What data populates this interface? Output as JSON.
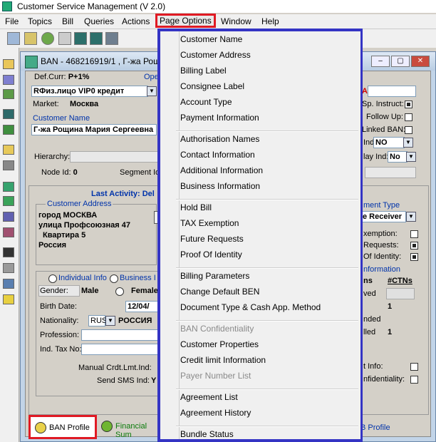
{
  "app": {
    "title": "Customer Service Management  (V 2.0)"
  },
  "menubar": [
    "File",
    "Topics",
    "Bill",
    "Queries",
    "Actions",
    "Page Options",
    "Window",
    "Help"
  ],
  "window": {
    "title": "BAN - 468216919/1 , Г-жа Рощ..."
  },
  "header": {
    "def_curr_label": "Def.Curr:",
    "def_curr_value": "P+1%",
    "ope_label": "Ope",
    "type_value": "RФиз.лицо  VIP0  кредит",
    "market_label": "Market:",
    "market_value": "Москва",
    "customer_name_label": "Customer Name",
    "customer_name_value": "Г-жа Рощина Мария Сергеевна",
    "hierarchy_label": "Hierarchy:",
    "node_id_label": "Node Id:",
    "node_id_value": "0",
    "segment_label": "Segment Id",
    "right_a": "A",
    "sp_instruct_label": "Sp. Instruct:",
    "follow_up_label": "Follow Up:",
    "linked_ban_label": "Linked BAN:",
    "ind_label": "Ind:",
    "ind_value": "NO",
    "lay_ind_label": "lay Ind:",
    "lay_ind_value": "No"
  },
  "main": {
    "last_activity": "Last Activity: Del",
    "customer_address_label": "Customer Address",
    "address_lines": [
      "город МОСКВА",
      "улица Профсоюзная  47",
      "  Квартира 5",
      "Россия"
    ],
    "individual_info": "Individual Info",
    "business_info": "Business I",
    "gender_label": "Gender:",
    "gender_value": "Male",
    "female_label": "Female",
    "birth_date_label": "Birth Date:",
    "birth_date_value": "12/04/",
    "nationality_label": "Nationality:",
    "nationality_code": "RUS",
    "nationality_value": "РОССИЯ",
    "profession_label": "Profession:",
    "ind_tax_label": "Ind. Tax No:",
    "manual_crdt_label": "Manual Crdt.Lmt.Ind:",
    "send_sms_label": "Send SMS Ind:",
    "send_sms_value": "Y",
    "right_panel": {
      "payment_type": "ment Type",
      "receiver": "e Receiver",
      "exemption": "xemption:",
      "requests": "Requests:",
      "of_identity": "Of Identity:",
      "information": "nformation",
      "ns": "ns",
      "ctns_header": "#CTNs",
      "ved": "ved",
      "one_a": "1",
      "nded": "nded",
      "lled": "lled",
      "one_b": "1",
      "t_info": "t Info:",
      "confidentiality": "nfidentiality:"
    }
  },
  "tabs": {
    "ban_profile": "BAN Profile",
    "financial": "Financial Sum",
    "b_profile": "B Profile"
  },
  "page_options_menu": [
    [
      {
        "label": "Customer Name",
        "enabled": true
      },
      {
        "label": "Customer Address",
        "enabled": true
      },
      {
        "label": "Billing Label",
        "enabled": true
      },
      {
        "label": "Consignee Label",
        "enabled": true
      },
      {
        "label": "Account Type",
        "enabled": true
      },
      {
        "label": "Payment Information",
        "enabled": true
      }
    ],
    [
      {
        "label": "Authorisation Names",
        "enabled": true
      },
      {
        "label": "Contact Information",
        "enabled": true
      },
      {
        "label": "Additional Information",
        "enabled": true
      },
      {
        "label": "Business Information",
        "enabled": true
      }
    ],
    [
      {
        "label": "Hold Bill",
        "enabled": true
      },
      {
        "label": "TAX Exemption",
        "enabled": true
      },
      {
        "label": "Future Requests",
        "enabled": true
      },
      {
        "label": "Proof Of Identity",
        "enabled": true
      }
    ],
    [
      {
        "label": "Billing Parameters",
        "enabled": true
      },
      {
        "label": "Change Default BEN",
        "enabled": true
      },
      {
        "label": "Document Type & Cash App. Method",
        "enabled": true
      }
    ],
    [
      {
        "label": "BAN Confidentiality",
        "enabled": false
      },
      {
        "label": "Customer Properties",
        "enabled": true
      },
      {
        "label": "Credit limit Information",
        "enabled": true
      },
      {
        "label": "Payer Number List",
        "enabled": false
      }
    ],
    [
      {
        "label": "Agreement List",
        "enabled": true
      },
      {
        "label": "Agreement History",
        "enabled": true
      }
    ],
    [
      {
        "label": "Bundle Status",
        "enabled": true
      }
    ]
  ],
  "colors": {
    "highlight_red": "#e01a24",
    "menu_border": "#3434c4",
    "label_blue": "#0033aa"
  }
}
